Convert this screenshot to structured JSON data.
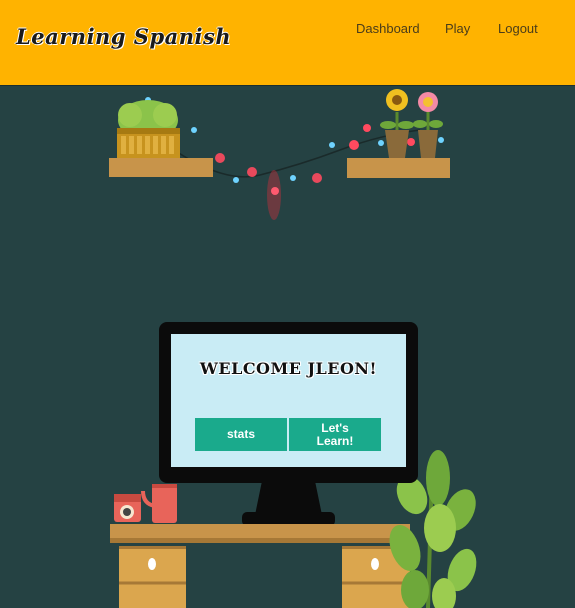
{
  "header": {
    "brand": "Learning Spanish",
    "nav": [
      "Dashboard",
      "Play",
      "Logout"
    ]
  },
  "screen": {
    "welcome": "WELCOME JLEON!",
    "stats_label": "stats",
    "learn_label_line1": "Let's",
    "learn_label_line2": "Learn!"
  },
  "colors": {
    "header": "#ffb300",
    "background": "#254243",
    "button": "#1aaa8c",
    "screen": "#c9ecf5"
  }
}
